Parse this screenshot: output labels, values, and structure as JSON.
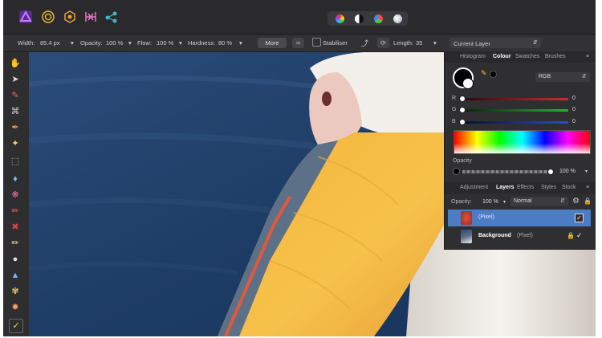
{
  "context_toolbar": {
    "width_label": "Width:",
    "width_value": "85.4 px",
    "opacity_label": "Opacity:",
    "opacity_value": "100 %",
    "flow_label": "Flow:",
    "flow_value": "100 %",
    "hardness_label": "Hardness:",
    "hardness_value": "80 %",
    "more_label": "More",
    "stabiliser_label": "Stabiliser",
    "length_label": "Length:",
    "length_value": "35",
    "source_value": "Current Layer",
    "dropdown_arrow": "▾"
  },
  "colour_panel": {
    "tabs": [
      "Histogram",
      "Colour",
      "Swatches",
      "Brushes"
    ],
    "active_tab": "Colour",
    "model": "RGB",
    "sliders": [
      {
        "label": "R",
        "value": "0",
        "color": "#c0282a"
      },
      {
        "label": "G",
        "value": "0",
        "color": "#2a9a3a"
      },
      {
        "label": "B",
        "value": "0",
        "color": "#2c4bd0"
      }
    ],
    "opacity_label": "Opacity",
    "opacity_value": "100 %"
  },
  "layers_panel": {
    "tabs": [
      "Adjustment",
      "Layers",
      "Effects",
      "Styles",
      "Stock"
    ],
    "active_tab": "Layers",
    "opacity_label": "Opacity:",
    "opacity_value": "100 %",
    "blend_mode": "Normal",
    "layers": [
      {
        "name": "",
        "kind": "(Pixel)",
        "selected": true
      },
      {
        "name": "Background",
        "kind": "(Pixel)",
        "selected": false
      }
    ]
  },
  "colors": {
    "accent": "#4c7cc4",
    "persona_photo": "#8b3dff",
    "app_bg": "#2c2c2e"
  },
  "icons": {
    "personas": [
      "photo-persona-icon",
      "liquify-persona-icon",
      "develop-persona-icon",
      "tone-mapping-persona-icon",
      "export-persona-icon"
    ],
    "modes": [
      "colour-wheel-mode-icon",
      "contrast-mode-icon",
      "colour-balance-mode-icon",
      "white-balance-mode-icon"
    ],
    "tools": [
      "view-hand-tool-icon",
      "move-tool-icon",
      "colour-picker-tool-icon",
      "crop-tool-icon",
      "paint-brush-tool-icon",
      "flood-select-tool-icon",
      "marquee-tool-icon",
      "fill-tool-icon",
      "paint-mixer-tool-icon",
      "brush-tool-icon",
      "dodge-tool-icon",
      "clone-tool-icon",
      "blur-tool-icon",
      "red-eye-tool-icon",
      "smudge-tool-icon",
      "inpainting-tool-icon",
      "selection-brush-tool-icon"
    ]
  }
}
